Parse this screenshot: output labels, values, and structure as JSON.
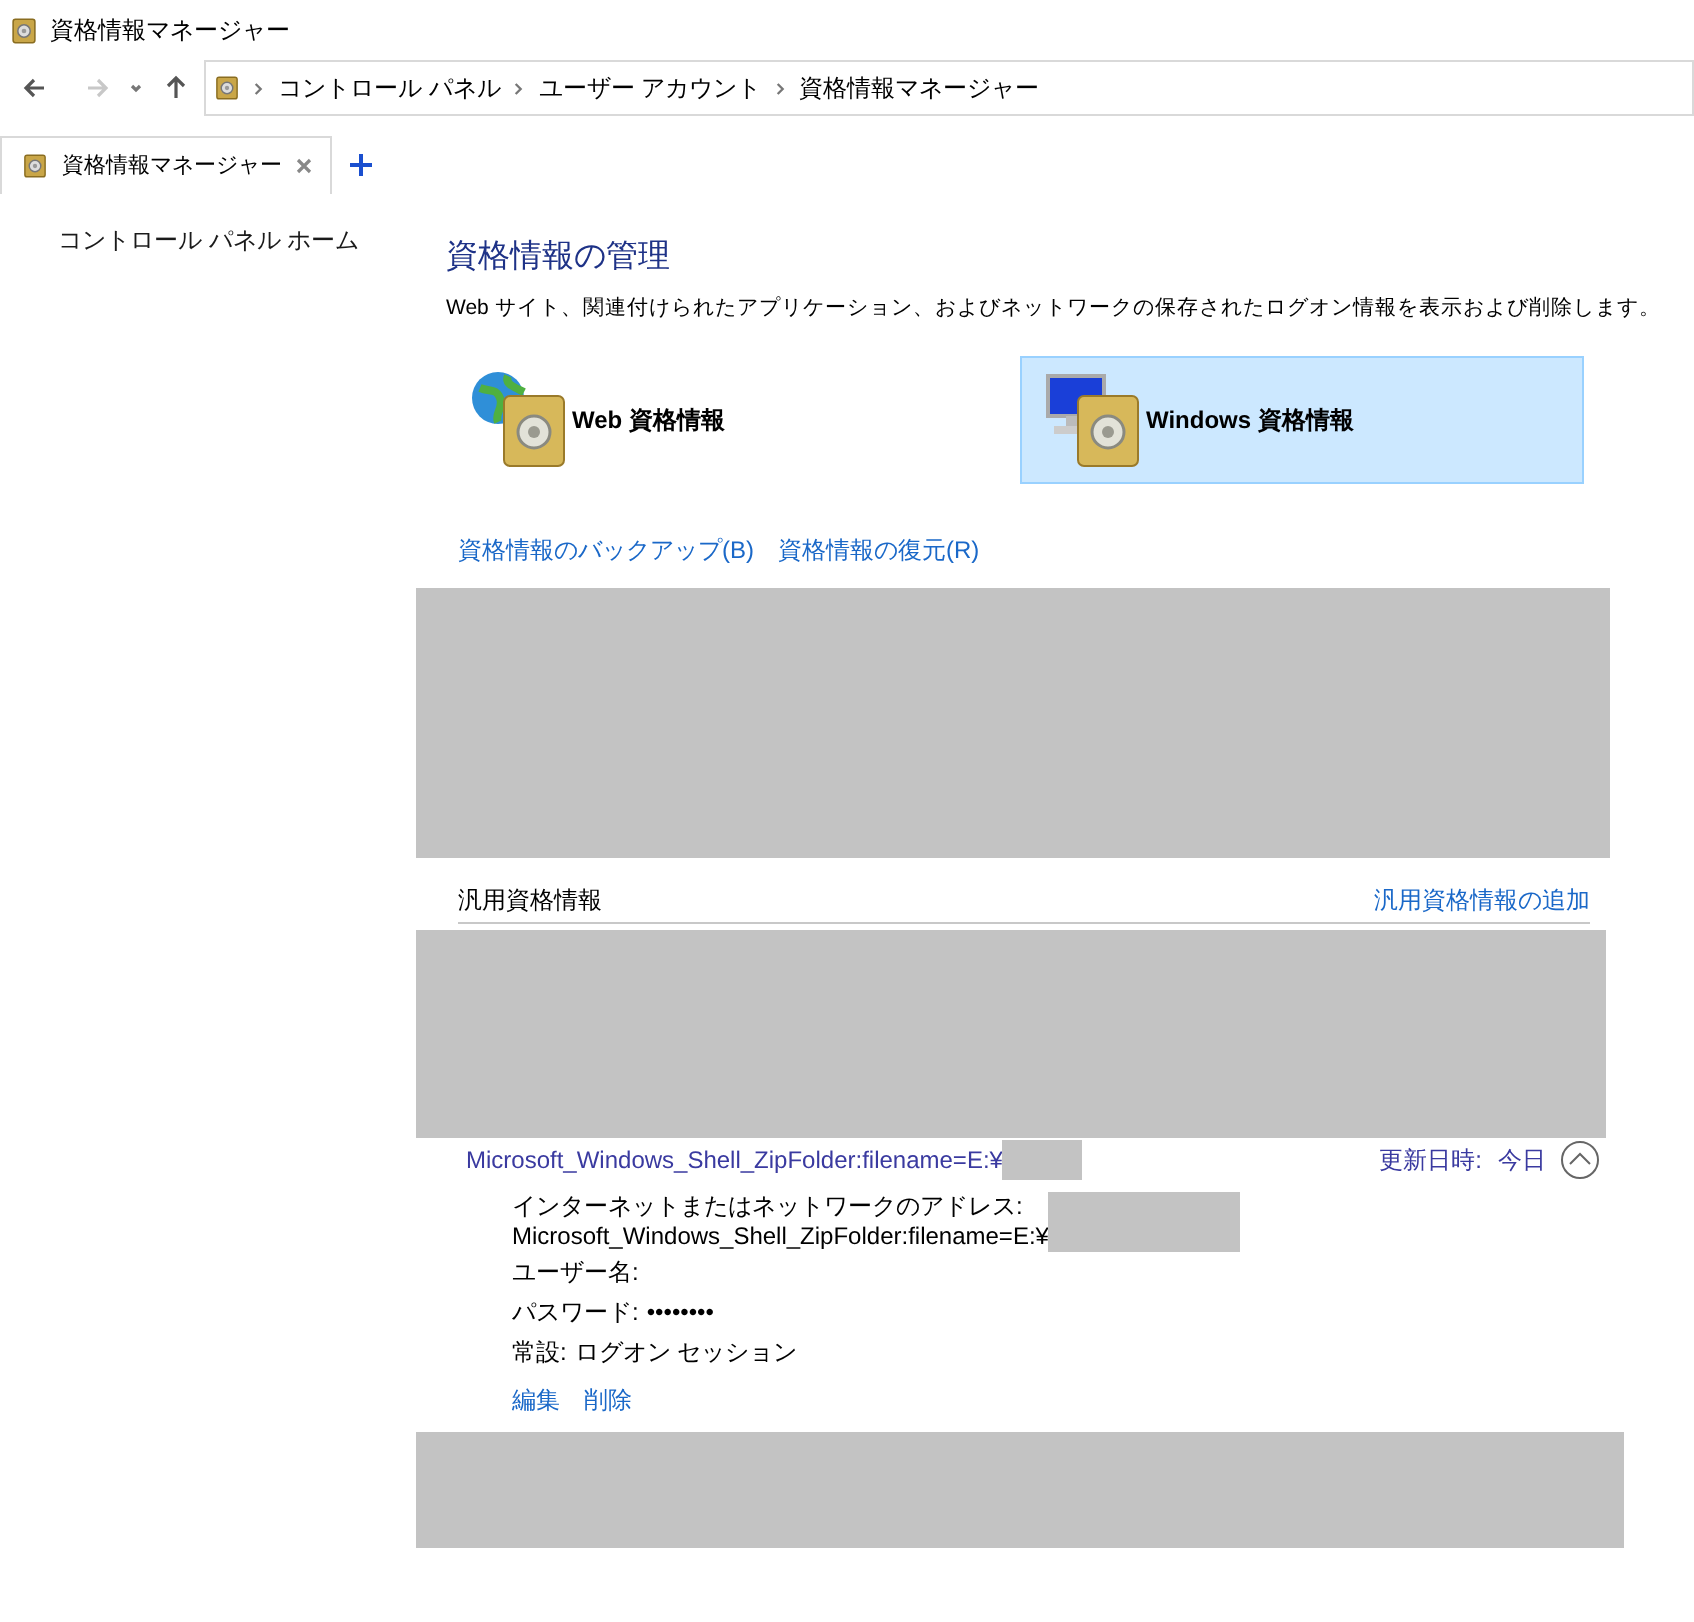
{
  "window": {
    "title": "資格情報マネージャー"
  },
  "address_bar": {
    "breadcrumbs": [
      "コントロール パネル",
      "ユーザー アカウント",
      "資格情報マネージャー"
    ]
  },
  "tabs": [
    {
      "label": "資格情報マネージャー",
      "selected": true
    }
  ],
  "sidebar": {
    "items": [
      "コントロール パネル ホーム"
    ]
  },
  "main": {
    "heading": "資格情報の管理",
    "description": "Web サイト、関連付けられたアプリケーション、およびネットワークの保存されたログオン情報を表示および削除します。",
    "credential_types": [
      {
        "label": "Web 資格情報",
        "kind": "web",
        "selected": false
      },
      {
        "label": "Windows 資格情報",
        "kind": "windows",
        "selected": true
      }
    ],
    "actions": [
      "資格情報のバックアップ(B)",
      "資格情報の復元(R)"
    ],
    "section": {
      "title": "汎用資格情報",
      "add_link": "汎用資格情報の追加",
      "entry": {
        "name": "Microsoft_Windows_Shell_ZipFolder:filename=E:¥",
        "modified_label": "更新日時:",
        "modified": "今日",
        "expanded": true,
        "details": [
          {
            "kind": "block",
            "label": "インターネットまたはネットワークのアドレス:",
            "value": "Microsoft_Windows_Shell_ZipFolder:filename=E:¥"
          },
          {
            "kind": "inline",
            "label": "ユーザー名:"
          },
          {
            "kind": "inline",
            "label": "パスワード:",
            "value": "••••••••"
          },
          {
            "kind": "inline",
            "label": "常設:",
            "value": "ログオン セッション"
          }
        ],
        "actions": [
          "編集",
          "削除"
        ]
      }
    }
  }
}
